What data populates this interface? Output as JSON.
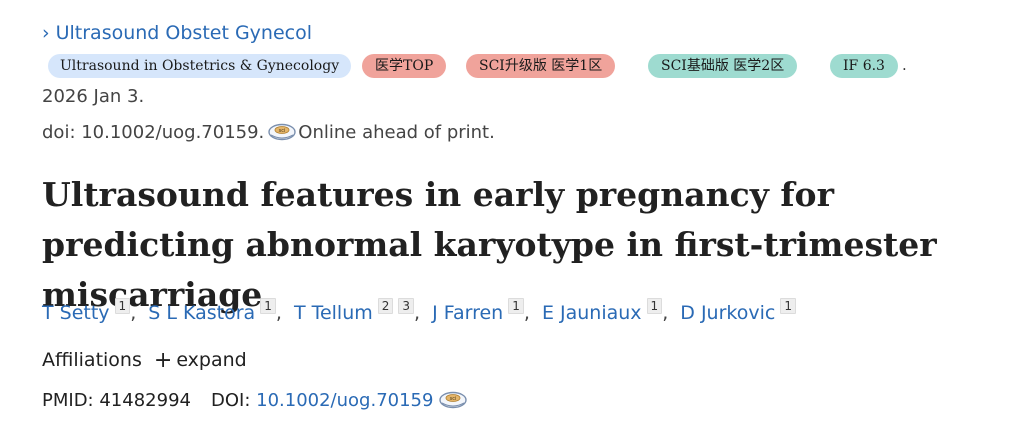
{
  "journal": {
    "chevron": "›",
    "name": "Ultrasound Obstet Gynecol"
  },
  "badges": {
    "full_name": "Ultrasound in Obstetrics & Gynecology",
    "top": "医学TOP",
    "sci_upgrade": "SCI升级版 医学1区",
    "sci_basic": "SCI基础版 医学2区",
    "impact_factor": "IF 6.3",
    "trailing_dot": "."
  },
  "pub": {
    "date": "2026 Jan 3.",
    "doi_text": "doi: 10.1002/uog.70159.",
    "status": "Online ahead of print."
  },
  "article": {
    "title": "Ultrasound features in early pregnancy for predicting abnormal karyotype in first-trimester miscarriage"
  },
  "authors": [
    {
      "name": "T Setty",
      "affils": [
        "1"
      ]
    },
    {
      "name": "S L Kastora",
      "affils": [
        "1"
      ]
    },
    {
      "name": "T Tellum",
      "affils": [
        "2",
        "3"
      ]
    },
    {
      "name": "J Farren",
      "affils": [
        "1"
      ]
    },
    {
      "name": "E Jauniaux",
      "affils": [
        "1"
      ]
    },
    {
      "name": "D Jurkovic",
      "affils": [
        "1"
      ]
    }
  ],
  "affiliations": {
    "label": "Affiliations",
    "plus": "+",
    "expand": "expand"
  },
  "ids": {
    "pmid_label": "PMID:",
    "pmid": "41482994",
    "doi_label": "DOI:",
    "doi": "10.1002/uog.70159"
  },
  "icons": {
    "doi_resolver": "scihub-doi-icon"
  },
  "colors": {
    "link": "#2a6ab5",
    "badge_blue": "#d6e6fb",
    "badge_red": "#f0a39b",
    "badge_teal": "#9edbd0"
  }
}
